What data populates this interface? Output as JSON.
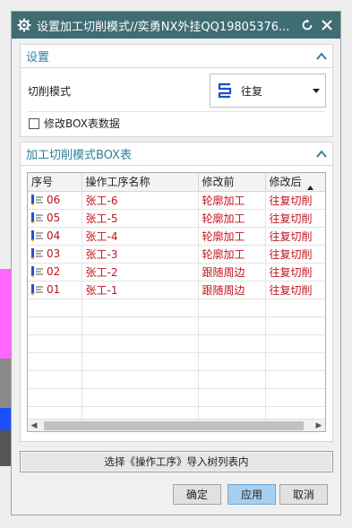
{
  "window": {
    "title": "设置加工切削模式//奕勇NX外挂QQ19805376...",
    "colors": {
      "titlebar": "#3f6d73",
      "group_header": "#2f7f9d",
      "row_text": "#c0141e",
      "apply_button": "#a8cfee"
    }
  },
  "settings": {
    "header": "设置",
    "mode_label": "切削模式",
    "mode_value": "往复",
    "checkbox_label": "修改BOX表数据"
  },
  "table_group": {
    "header": "加工切削模式BOX表",
    "columns": [
      "序号",
      "操作工序名称",
      "修改前",
      "修改后"
    ],
    "rows": [
      [
        "06",
        "张工-6",
        "轮廓加工",
        "往复切削"
      ],
      [
        "05",
        "张工-5",
        "轮廓加工",
        "往复切削"
      ],
      [
        "04",
        "张工-4",
        "轮廓加工",
        "往复切削"
      ],
      [
        "03",
        "张工-3",
        "轮廓加工",
        "往复切削"
      ],
      [
        "02",
        "张工-2",
        "跟随周边",
        "往复切削"
      ],
      [
        "01",
        "张工-1",
        "跟随周边",
        "往复切削"
      ]
    ],
    "scroll_left": "◀",
    "scroll_right": "▶"
  },
  "import_button": "选择《操作工序》导入树列表内",
  "buttons": {
    "ok": "确定",
    "apply": "应用",
    "cancel": "取消"
  },
  "icons": [
    "gear-icon",
    "reset-icon",
    "close-icon",
    "collapse-chevron-icon",
    "zigzag-mode-icon",
    "dropdown-arrow-icon",
    "operation-icon"
  ]
}
